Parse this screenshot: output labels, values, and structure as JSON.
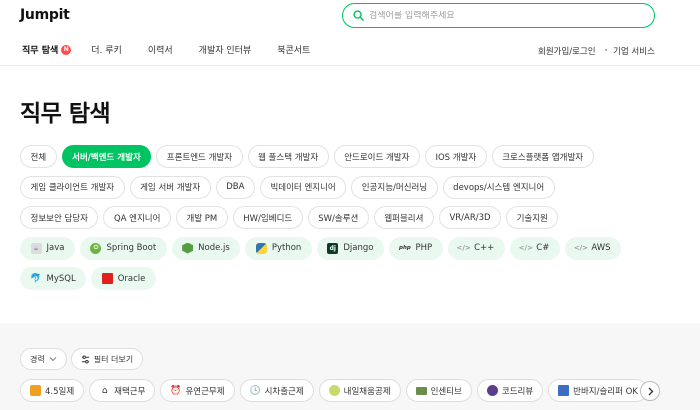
{
  "header": {
    "logo": "Jumpit",
    "search": {
      "placeholder": "검색어를 입력해주세요"
    },
    "nav": [
      {
        "label": "직무 탐색",
        "badge": "N"
      },
      {
        "label": "더. 루키"
      },
      {
        "label": "이력서"
      },
      {
        "label": "개발자 인터뷰"
      },
      {
        "label": "북콘서트"
      }
    ],
    "login_label": "회원가입/로그인",
    "business_label": "기업 서비스"
  },
  "page_title": "직무 탐색",
  "job_categories": [
    [
      "전체",
      "서버/백엔드 개발자",
      "프론트엔드 개발자",
      "웹 풀스택 개발자",
      "안드로이드 개발자",
      "IOS 개발자",
      "크로스플랫폼 앱개발자"
    ],
    [
      "게임 클라이언트 개발자",
      "게임 서버 개발자",
      "DBA",
      "빅데이터 엔지니어",
      "인공지능/머신러닝",
      "devops/시스템 엔지니어"
    ],
    [
      "정보보안 담당자",
      "QA 엔지니어",
      "개발 PM",
      "HW/임베디드",
      "SW/솔루션",
      "웹퍼블리셔",
      "VR/AR/3D",
      "기술지원"
    ]
  ],
  "selected_category": "서버/백엔드 개발자",
  "tech_stacks": [
    [
      {
        "label": "Java",
        "icon": "java-icon",
        "color": "#e8e8e8"
      },
      {
        "label": "Spring Boot",
        "icon": "spring-boot-icon",
        "color": "#6db33f"
      },
      {
        "label": "Node.js",
        "icon": "nodejs-icon",
        "color": "#539e43"
      },
      {
        "label": "Python",
        "icon": "python-icon",
        "color": "#3776ab"
      },
      {
        "label": "Django",
        "icon": "django-icon",
        "color": "#0c3c26"
      },
      {
        "label": "PHP",
        "icon": "php-icon",
        "color": "#333333"
      },
      {
        "label": "C++",
        "icon": "code-icon",
        "color": "#9a9a9a"
      },
      {
        "label": "C#",
        "icon": "code-icon",
        "color": "#9a9a9a"
      },
      {
        "label": "AWS",
        "icon": "code-icon",
        "color": "#9a9a9a"
      }
    ],
    [
      {
        "label": "MySQL",
        "icon": "mysql-icon",
        "color": "#4479a1"
      },
      {
        "label": "Oracle",
        "icon": "oracle-icon",
        "color": "#e0201f"
      }
    ]
  ],
  "filters": {
    "career_label": "경력",
    "more_filters_label": "필터 더보기"
  },
  "benefit_tags": [
    {
      "label": "4.5일제",
      "icon": "calendar-icon"
    },
    {
      "label": "재택근무",
      "icon": "home-icon"
    },
    {
      "label": "유연근무제",
      "icon": "alarm-clock-icon"
    },
    {
      "label": "시차출근제",
      "icon": "clock-icon"
    },
    {
      "label": "내일채움공제",
      "icon": "piggy-bank-icon"
    },
    {
      "label": "인센티브",
      "icon": "money-icon"
    },
    {
      "label": "코드리뷰",
      "icon": "code-review-icon"
    },
    {
      "label": "반바지/슬리퍼 OK",
      "icon": "shorts-icon"
    }
  ],
  "colors": {
    "accent": "#00c362",
    "tech_chip_bg": "#eaf9f0",
    "badge_red": "#ff4b4b"
  }
}
